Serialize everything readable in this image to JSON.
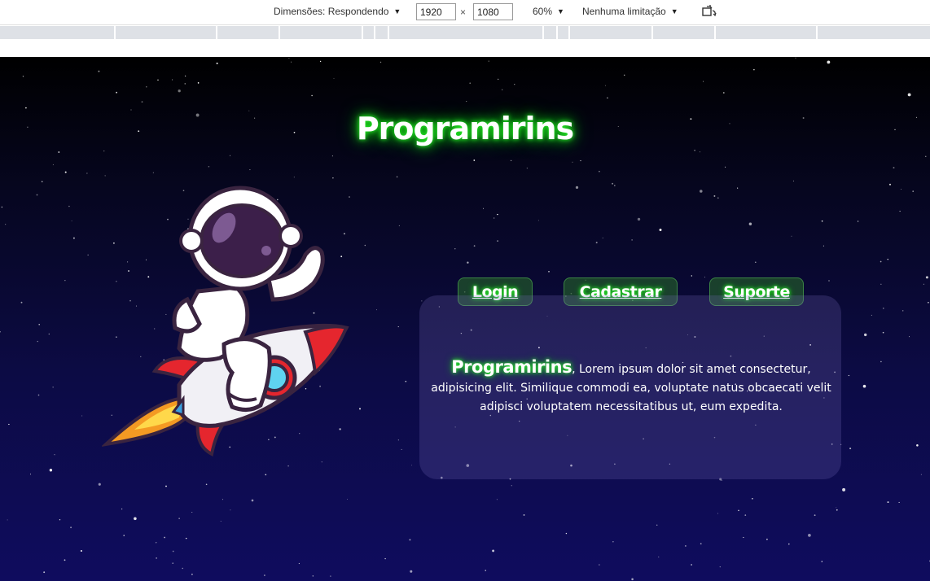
{
  "devtools": {
    "dimensions_label": "Dimensões: Respondendo",
    "width_value": "1920",
    "times": "×",
    "height_value": "1080",
    "zoom": "60%",
    "throttle": "Nenhuma limitação",
    "rotate_icon": "rotate-icon"
  },
  "site": {
    "title": "Programirins",
    "nav": [
      {
        "label": "Login"
      },
      {
        "label": "Cadastrar"
      },
      {
        "label": "Suporte"
      }
    ],
    "card": {
      "brand": "Programirins",
      "text": ", Lorem ipsum dolor sit amet consectetur, adipisicing elit. Similique commodi ea, voluptate natus obcaecati velit adipisci voluptatem necessitatibus ut, eum expedita."
    }
  },
  "colors": {
    "glow": "#2cff2c",
    "sky_top": "#000000",
    "sky_bottom": "#0f0c5e"
  }
}
